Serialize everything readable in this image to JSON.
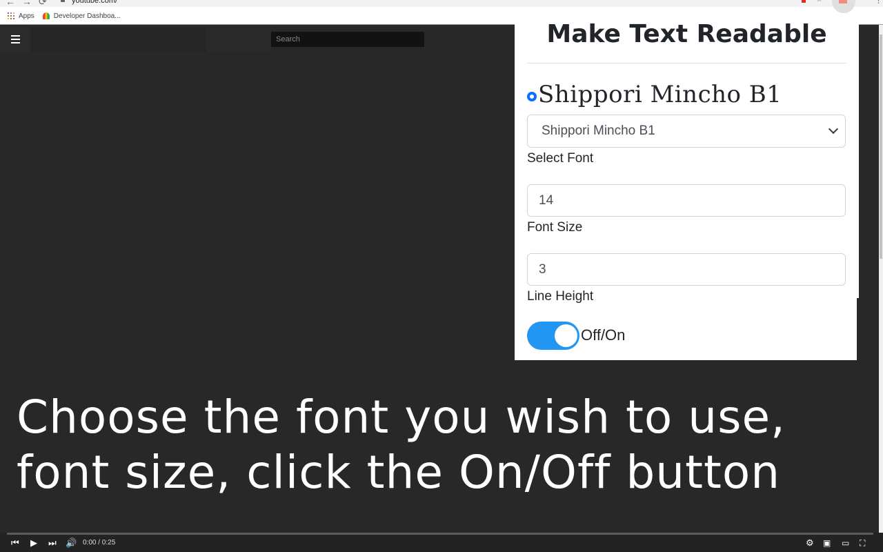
{
  "browser": {
    "url": "youtube.com/",
    "bookmarks": [
      {
        "label": "Apps",
        "icon": "apps-grid-icon"
      },
      {
        "label": "Developer Dashboa...",
        "icon": "chrome-web-store-icon"
      }
    ]
  },
  "youtube": {
    "search_placeholder": "Search",
    "caption": "Choose the font you wish to use,\nfont size, click the On/Off button",
    "player": {
      "time": "0:00 / 0:25",
      "progress": 0
    }
  },
  "panel": {
    "title": "Make Text Readable",
    "preview_font_name": "Shippori Mincho B1",
    "font_select": {
      "value": "Shippori Mincho B1",
      "label": "Select Font"
    },
    "font_size": {
      "value": "14",
      "label": "Font Size"
    },
    "line_height": {
      "value": "3",
      "label": "Line Height"
    },
    "toggle": {
      "label": "Off/On",
      "checked": true
    },
    "colors": {
      "accent": "#2196f3",
      "radio": "#0d6efd"
    }
  }
}
